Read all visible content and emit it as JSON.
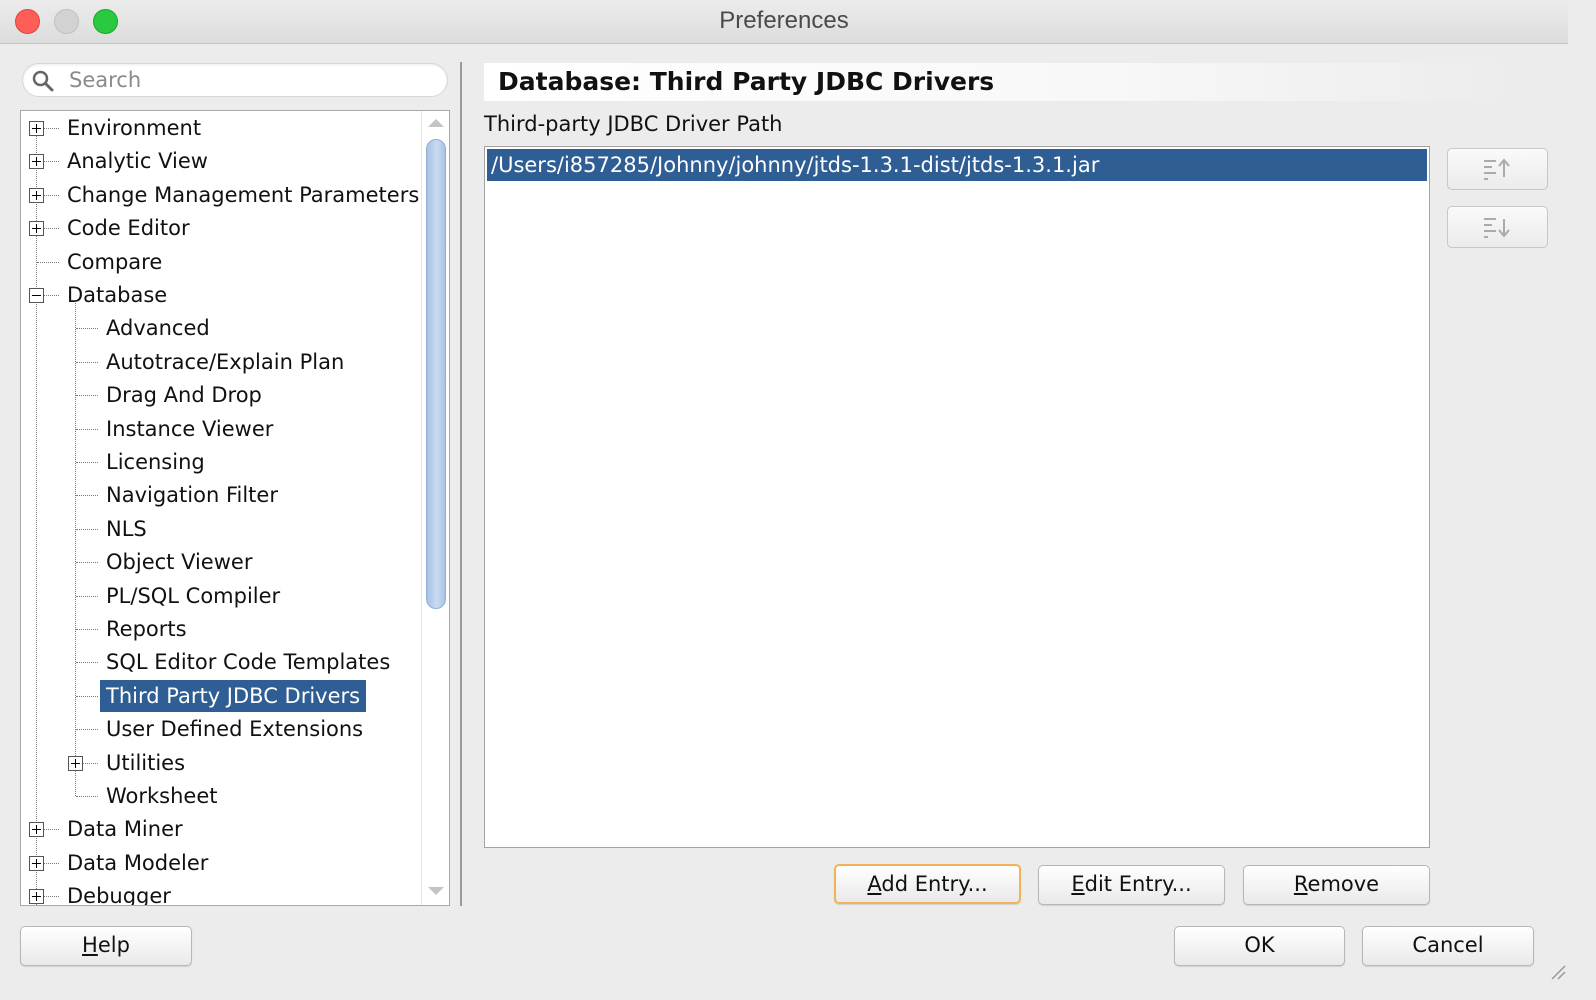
{
  "window": {
    "title": "Preferences"
  },
  "search": {
    "placeholder": "Search"
  },
  "tree": {
    "items": [
      {
        "label": "Environment",
        "level": 0,
        "expander": "plus"
      },
      {
        "label": "Analytic View",
        "level": 0,
        "expander": "plus"
      },
      {
        "label": "Change Management Parameters",
        "level": 0,
        "expander": "plus"
      },
      {
        "label": "Code Editor",
        "level": 0,
        "expander": "plus"
      },
      {
        "label": "Compare",
        "level": 0,
        "expander": "none"
      },
      {
        "label": "Database",
        "level": 0,
        "expander": "minus"
      },
      {
        "label": "Advanced",
        "level": 1,
        "expander": "none"
      },
      {
        "label": "Autotrace/Explain Plan",
        "level": 1,
        "expander": "none"
      },
      {
        "label": "Drag And Drop",
        "level": 1,
        "expander": "none"
      },
      {
        "label": "Instance Viewer",
        "level": 1,
        "expander": "none"
      },
      {
        "label": "Licensing",
        "level": 1,
        "expander": "none"
      },
      {
        "label": "Navigation Filter",
        "level": 1,
        "expander": "none"
      },
      {
        "label": "NLS",
        "level": 1,
        "expander": "none"
      },
      {
        "label": "Object Viewer",
        "level": 1,
        "expander": "none"
      },
      {
        "label": "PL/SQL Compiler",
        "level": 1,
        "expander": "none"
      },
      {
        "label": "Reports",
        "level": 1,
        "expander": "none"
      },
      {
        "label": "SQL Editor Code Templates",
        "level": 1,
        "expander": "none"
      },
      {
        "label": "Third Party JDBC Drivers",
        "level": 1,
        "expander": "none",
        "selected": true
      },
      {
        "label": "User Defined Extensions",
        "level": 1,
        "expander": "none"
      },
      {
        "label": "Utilities",
        "level": 1,
        "expander": "plus"
      },
      {
        "label": "Worksheet",
        "level": 1,
        "expander": "none"
      },
      {
        "label": "Data Miner",
        "level": 0,
        "expander": "plus"
      },
      {
        "label": "Data Modeler",
        "level": 0,
        "expander": "plus"
      },
      {
        "label": "Debugger",
        "level": 0,
        "expander": "plus"
      }
    ]
  },
  "panel": {
    "heading": "Database: Third Party JDBC Drivers",
    "path_label": "Third-party JDBC Driver Path",
    "entries": [
      "/Users/i857285/Johnny/johnny/jtds-1.3.1-dist/jtds-1.3.1.jar"
    ],
    "move_up_icon": "move-up-icon",
    "move_down_icon": "move-down-icon",
    "add_entry": {
      "mnemonic": "A",
      "rest": "dd Entry..."
    },
    "edit_entry": {
      "mnemonic": "E",
      "rest": "dit Entry..."
    },
    "remove": {
      "mnemonic": "R",
      "rest": "emove"
    }
  },
  "footer": {
    "help": {
      "mnemonic": "H",
      "rest": "elp"
    },
    "ok": "OK",
    "cancel": "Cancel"
  },
  "colors": {
    "selection": "#2e5e93",
    "default_button_border": "#f2b356",
    "close": "#fd5f57",
    "maximize": "#29c940"
  }
}
